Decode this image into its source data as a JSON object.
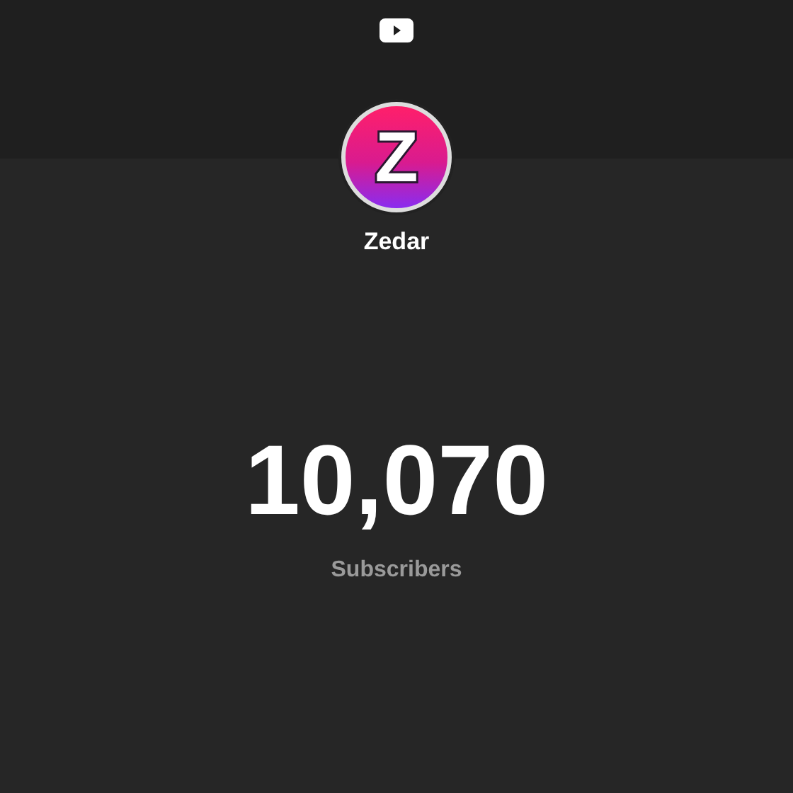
{
  "channel": {
    "avatar_letter": "Z",
    "name": "Zedar"
  },
  "counter": {
    "count": "10,070",
    "label": "Subscribers"
  }
}
